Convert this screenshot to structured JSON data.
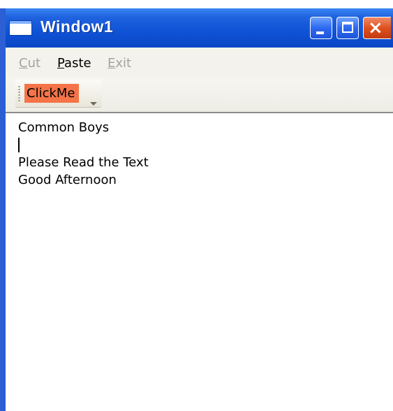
{
  "window": {
    "title": "Window1",
    "close_glyph": "×",
    "icons": {
      "app": "window-app-icon",
      "minimize": "minimize-icon",
      "maximize": "maximize-icon",
      "close": "close-icon"
    },
    "colors": {
      "titlebar": "#0f52d6",
      "close_button": "#e0501e",
      "frame": "#2b5fd3"
    }
  },
  "menu": {
    "items": [
      {
        "access_key": "C",
        "rest": "ut",
        "enabled": false
      },
      {
        "access_key": "P",
        "rest": "aste",
        "enabled": true
      },
      {
        "access_key": "E",
        "rest": "xit",
        "enabled": false
      }
    ]
  },
  "toolbar": {
    "click_me_label": "ClickMe",
    "click_me_color": "#f47448",
    "overflow_icon": "chevron-down-icon"
  },
  "editor": {
    "lines": [
      "Common Boys",
      "",
      "Please Read the Text",
      "Good Afternoon"
    ],
    "caret_line": 2
  }
}
